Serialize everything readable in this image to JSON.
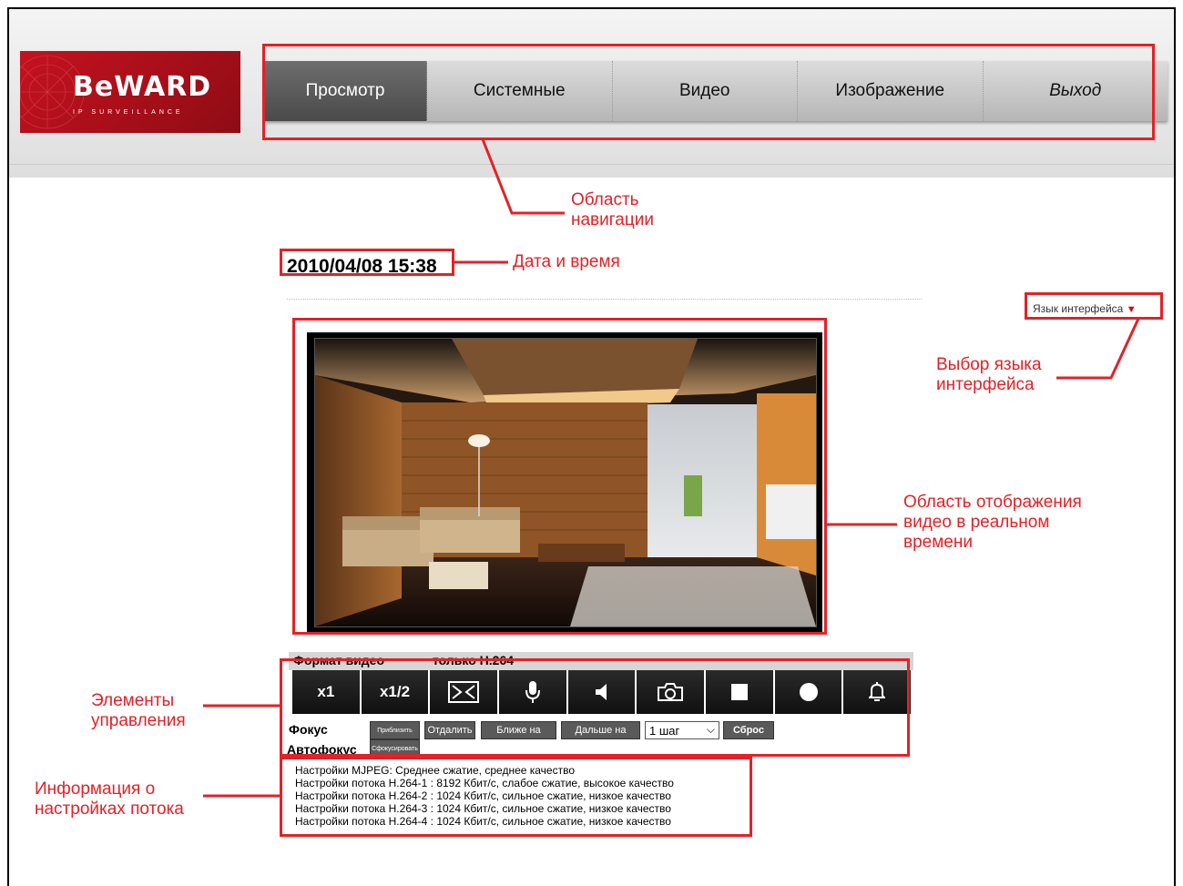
{
  "nav": {
    "logo_text": "BeWARD",
    "logo_sub": "IP SURVEILLANCE",
    "items": [
      {
        "label": "Просмотр"
      },
      {
        "label": "Системные"
      },
      {
        "label": "Видео"
      },
      {
        "label": "Изображение"
      },
      {
        "label": "Выход"
      }
    ]
  },
  "datetime": "2010/04/08 15:38",
  "language": {
    "label": "Язык интерфейса"
  },
  "format": {
    "label": "Формат видео",
    "value": "только H.264"
  },
  "controls": {
    "buttons": [
      {
        "label": "x1",
        "icon": ""
      },
      {
        "label": "x1/2",
        "icon": ""
      },
      {
        "label": "",
        "icon": "fit-screen-icon"
      },
      {
        "label": "",
        "icon": "microphone-icon"
      },
      {
        "label": "",
        "icon": "speaker-icon"
      },
      {
        "label": "",
        "icon": "camera-icon"
      },
      {
        "label": "",
        "icon": "stop-icon"
      },
      {
        "label": "",
        "icon": "record-icon"
      },
      {
        "label": "",
        "icon": "bell-icon"
      }
    ],
    "focus_label": "Фокус",
    "autofocus_label": "Автофокус",
    "zoom_in": "Приблизить",
    "zoom_out": "Отдалить",
    "near": "Ближе на",
    "far": "Дальше на",
    "step": "1 шаг",
    "reset": "Сброс",
    "autofocus_button": "Сфокусировать"
  },
  "stream_info": [
    "Настройки MJPEG: Среднее сжатие, среднее качество",
    "Настройки потока H.264-1 : 8192 Кбит/с, слабое сжатие, высокое качество",
    "Настройки потока H.264-2 : 1024 Кбит/с, сильное сжатие, низкое качество",
    "Настройки потока H.264-3 : 1024 Кбит/с, сильное сжатие, низкое качество",
    "Настройки потока H.264-4 : 1024 Кбит/с, сильное сжатие, низкое качество"
  ],
  "annotations": {
    "nav_area": [
      "Область",
      "навигации"
    ],
    "datetime": "Дата и время",
    "language": [
      "Выбор языка",
      "интерфейса"
    ],
    "video": [
      "Область отображения",
      "видео в реальном",
      "времени"
    ],
    "controls": [
      "Элементы",
      "управления"
    ],
    "stream": [
      "Информация о",
      "настройках потока"
    ]
  },
  "colors": {
    "annotation": "#e32127",
    "logo": "#c5121f"
  }
}
